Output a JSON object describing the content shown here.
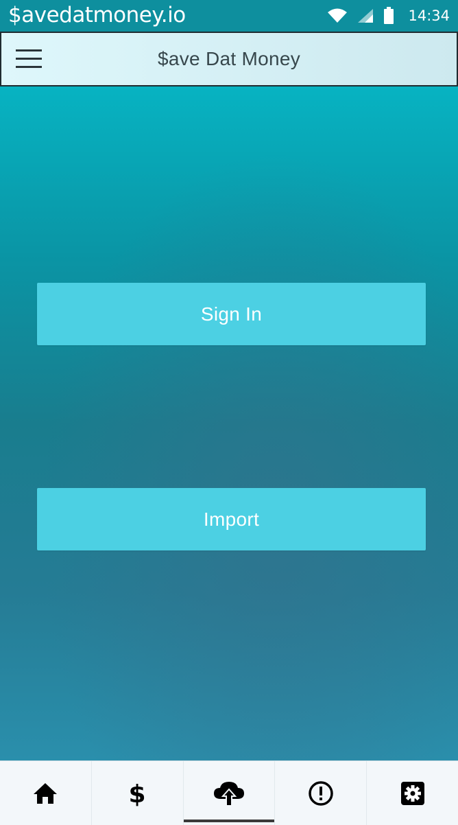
{
  "status_bar": {
    "title": "$avedatmoney.io",
    "time": "14:34",
    "icons": [
      "wifi-icon",
      "signal-icon",
      "battery-icon"
    ]
  },
  "header": {
    "title": "$ave Dat Money",
    "menu_icon": "hamburger-menu-icon"
  },
  "main": {
    "buttons": [
      {
        "label": "Sign In"
      },
      {
        "label": "Import"
      }
    ]
  },
  "tab_bar": {
    "tabs": [
      {
        "icon": "home-icon",
        "active": false
      },
      {
        "icon": "dollar-icon",
        "active": false
      },
      {
        "icon": "cloud-upload-icon",
        "active": true
      },
      {
        "icon": "alert-circle-icon",
        "active": false
      },
      {
        "icon": "settings-gear-icon",
        "active": false
      }
    ]
  },
  "colors": {
    "status_bar": "#0e8f9e",
    "button": "#4cd0e3",
    "header": "#def7fb",
    "tab_bar": "#f3f7fa"
  }
}
